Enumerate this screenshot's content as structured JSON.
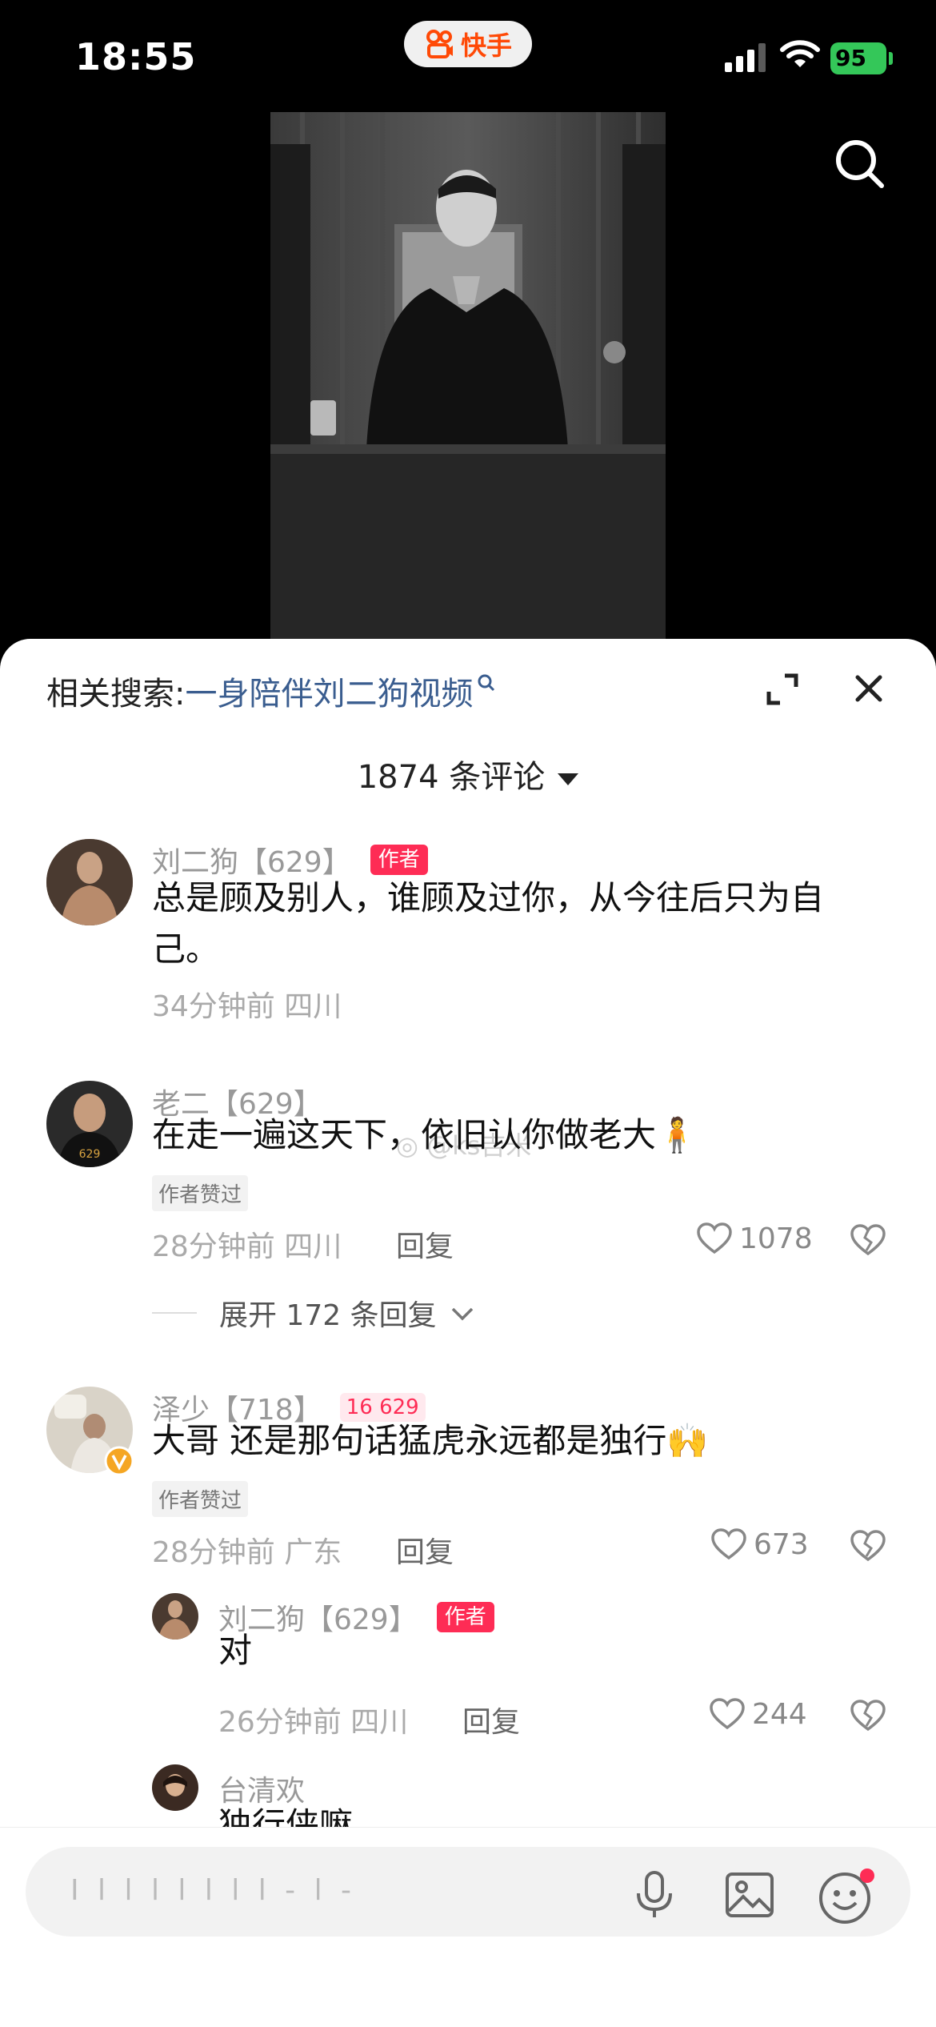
{
  "status": {
    "time": "18:55",
    "app_name": "快手",
    "battery": "95"
  },
  "sheet": {
    "related_prefix": "相关搜索:",
    "related_keyword": "一身陪伴刘二狗视频",
    "comment_count": "1874 条评论"
  },
  "comments": [
    {
      "user": "刘二狗【629】",
      "tag": "作者",
      "text": "总是顾及别人，谁顾及过你，从今往后只为自己。",
      "meta": "34分钟前 四川"
    },
    {
      "user": "老二【629】",
      "text": "在走一遍这天下，依旧认你做老大🧍",
      "liked": "作者赞过",
      "meta": "28分钟前 四川",
      "reply": "回复",
      "likes": "1078",
      "expand": "展开 172 条回复"
    },
    {
      "user": "泽少【718】",
      "badge": "16 629",
      "text": "大哥 还是那句话猛虎永远都是独行🙌",
      "liked": "作者赞过",
      "meta": "28分钟前 广东",
      "reply": "回复",
      "likes": "673"
    },
    {
      "user": "刘二狗【629】",
      "tag": "作者",
      "text": "对",
      "meta": "26分钟前 四川",
      "reply": "回复",
      "likes": "244"
    },
    {
      "user": "台清欢",
      "text": "独行侠嘛"
    }
  ],
  "watermark": "@ks吉米",
  "input": {
    "placeholder": "I l l l l l l l - l -"
  },
  "colors": {
    "accent": "#fe2c55",
    "keyword": "#3a5d8f",
    "brand": "#ff4906"
  }
}
